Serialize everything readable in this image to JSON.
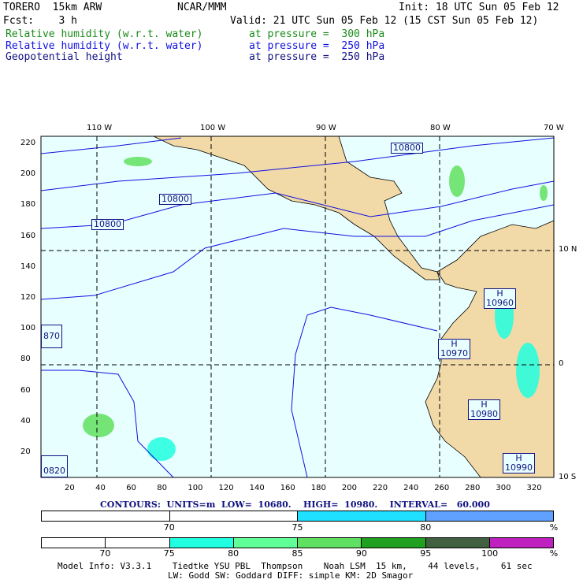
{
  "header": {
    "model": "TORERO  15km ARW",
    "org": "NCAR/MMM",
    "init": "Init: 18 UTC Sun 05 Feb 12",
    "fcst": "Fcst:    3 h",
    "valid": "Valid: 21 UTC Sun 05 Feb 12 (15 CST Sun 05 Feb 12)",
    "fields": [
      {
        "name": "Relative humidity (w.r.t. water)",
        "level": "at pressure =  300 hPa",
        "color": "#1a8a1a"
      },
      {
        "name": "Relative humidity (w.r.t. water)",
        "level": "at pressure =  250 hPa",
        "color": "#1010e0"
      },
      {
        "name": "Geopotential height",
        "level": "at pressure =  250 hPa",
        "color": "#101080"
      }
    ]
  },
  "map": {
    "top_ticks": [
      "110 W",
      "100 W",
      "90 W",
      "80 W",
      "70 W"
    ],
    "right_ticks": [
      "10 N",
      "0",
      "10 S"
    ],
    "left_ticks": [
      "220",
      "200",
      "180",
      "160",
      "140",
      "120",
      "100",
      "80",
      "60",
      "40",
      "20"
    ],
    "bottom_ticks": [
      "20",
      "40",
      "60",
      "80",
      "100",
      "120",
      "140",
      "160",
      "180",
      "200",
      "220",
      "240",
      "260",
      "280",
      "300",
      "320"
    ],
    "contour_labels": [
      "10800",
      "10800",
      "10800",
      "H\n10960",
      "H\n10970",
      "H\n10980",
      "H\n10990",
      "870",
      "0820"
    ]
  },
  "contours_info": "CONTOURS:  UNITS=m  LOW=  10680.    HIGH=  10980.    INTERVAL=   60.000",
  "legend1": {
    "colors": [
      "#ffffff",
      "#ffffff",
      "#20e0ff",
      "#60a0ff"
    ],
    "ticks": [
      "70",
      "75",
      "80",
      "%"
    ]
  },
  "legend2": {
    "colors": [
      "#ffffff",
      "#ffffff",
      "#20ffe0",
      "#60ff98",
      "#60e060",
      "#20a020",
      "#406040",
      "#c020c0"
    ],
    "ticks": [
      "70",
      "75",
      "80",
      "85",
      "90",
      "95",
      "100",
      "%"
    ]
  },
  "footer": {
    "line1": "Model Info: V3.3.1    Tiedtke YSU PBL  Thompson    Noah LSM  15 km,    44 levels,    61 sec",
    "line2": "LW: Godd SW: Goddard DIFF: simple KM: 2D Smagor"
  }
}
